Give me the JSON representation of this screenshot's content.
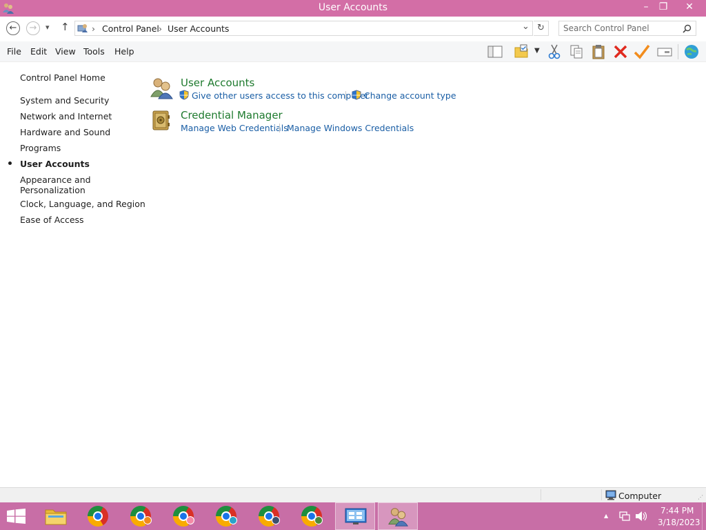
{
  "window": {
    "title": "User Accounts",
    "minimize": "–",
    "restore": "❐",
    "close": "✕"
  },
  "nav": {
    "back": "←",
    "forward": "→",
    "recent": "▾",
    "up": "↑"
  },
  "address": {
    "crumbs": [
      "Control Panel",
      "User Accounts"
    ],
    "separator": "›",
    "dropdown": "⌄",
    "refresh": "↻"
  },
  "search": {
    "placeholder": "Search Control Panel",
    "icon": "search-icon"
  },
  "menubar": {
    "items": [
      "File",
      "Edit",
      "View",
      "Tools",
      "Help"
    ]
  },
  "toolbar": {
    "icons": [
      "layout-pane-icon",
      "folder-options-icon",
      "dropdown-icon",
      "cut-icon",
      "copy-icon",
      "paste-icon",
      "delete-icon",
      "properties-check-icon",
      "rename-icon",
      "globe-icon"
    ]
  },
  "sidebar": {
    "items": [
      {
        "label": "Control Panel Home"
      },
      {
        "label": "System and Security"
      },
      {
        "label": "Network and Internet"
      },
      {
        "label": "Hardware and Sound"
      },
      {
        "label": "Programs"
      },
      {
        "label": "User Accounts",
        "selected": true
      },
      {
        "label": "Appearance and Personalization"
      },
      {
        "label": "Clock, Language, and Region"
      },
      {
        "label": "Ease of Access"
      }
    ]
  },
  "main": {
    "categories": [
      {
        "title": "User Accounts",
        "icon": "user-accounts-icon",
        "links": [
          "Give other users access to this computer",
          "Change account type"
        ]
      },
      {
        "title": "Credential Manager",
        "icon": "credential-manager-icon",
        "links": [
          "Manage Web Credentials",
          "Manage Windows Credentials"
        ]
      }
    ]
  },
  "statusbar": {
    "computer_label": "Computer"
  },
  "taskbar": {
    "clock_time": "7:44 PM",
    "clock_date": "3/18/2023",
    "tray_chevron": "▲"
  },
  "colors": {
    "titlebar": "#d36ea6",
    "taskbar": "#c86ea6",
    "link": "#1a5ea5",
    "category_title": "#1e7a2e"
  }
}
